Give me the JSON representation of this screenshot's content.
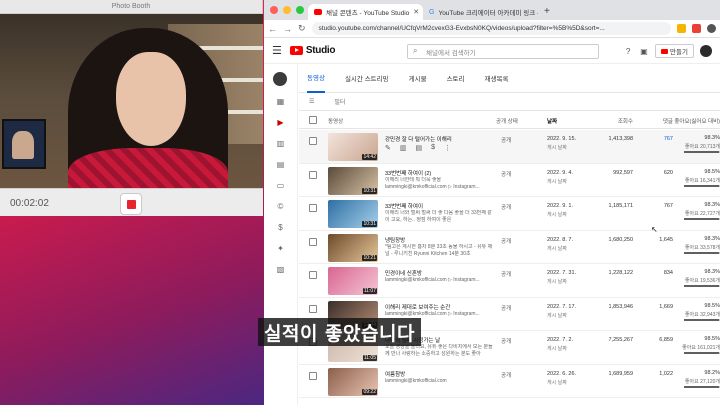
{
  "photo_booth": {
    "title": "Photo Booth",
    "timer": "00:02:02"
  },
  "browser": {
    "tabs": [
      {
        "label": "채널 콘텐츠 - YouTube Studio",
        "active": true
      },
      {
        "label": "YouTube 크리에이터 아카데미 링크 - ",
        "active": false
      }
    ],
    "new_tab": "+",
    "url": "studio.youtube.com/channel/UCfqVrM2cvexG3-EvxbsN0KQ/videos/upload?filter=%5B%5D&sort=..."
  },
  "studio": {
    "logo": "Studio",
    "search_placeholder": "채널에서 검색하기",
    "create_label": "만들기",
    "tabs": [
      "동영상",
      "실시간 스트리밍",
      "게시물",
      "스토리",
      "재생목록"
    ],
    "filter_label": "필터",
    "columns": {
      "video": "동영상",
      "visibility": "공개 상태",
      "date": "날짜",
      "views": "조회수",
      "comments": "댓글",
      "likes": "좋아요(싫어요 대비)"
    },
    "videos": [
      {
        "title": "강민경 잘 다 털어가는 이해리",
        "desc": "",
        "duration": "14:42",
        "visibility": "공개",
        "date": "2022. 9. 15.",
        "status": "게시 날짜",
        "views": "1,413,398",
        "comments": "767",
        "comments_link": true,
        "like_pct": "98.3%",
        "like_count": "좋아요 20,713개",
        "like_ratio": 0.983,
        "thumb": [
          "#f2e4dc",
          "#c9a48e"
        ],
        "hover": true
      },
      {
        "title": "33번번째 하여이 (2)",
        "desc": "이해리 너한테 뭐 더욱 좋을 lammingki@kmkofficial.com ▷ Instagram...",
        "duration": "10:31",
        "visibility": "공개",
        "date": "2022. 9. 4.",
        "status": "게시 날짜",
        "views": "992,597",
        "comments": "620",
        "comments_link": false,
        "like_pct": "98.5%",
        "like_count": "좋아요 16,341개",
        "like_ratio": 0.985,
        "thumb": [
          "#5a4a3a",
          "#d9c3a6"
        ],
        "hover": false
      },
      {
        "title": "33번번째 하여이",
        "desc": "이해리 너와 벌써 벌써 더 좋 다음 좋을 더 33번째 같이 고요, 하는.. 정점 하여이 좋은",
        "duration": "10:31",
        "visibility": "공개",
        "date": "2022. 9. 1.",
        "status": "게시 날짜",
        "views": "1,185,171",
        "comments": "767",
        "comments_link": false,
        "like_pct": "98.3%",
        "like_count": "좋아요 22,727개",
        "like_ratio": 0.983,
        "thumb": [
          "#2d6fa3",
          "#a7d0ea"
        ],
        "hover": false
      },
      {
        "title": "냉팀장방",
        "desc": "*팀고은 계시한 흥차 8분 33초 동물 하시고 - 유튜 채널 - 루니키친 Ryunni Kitchen 14분 30초",
        "duration": "10:21",
        "visibility": "공개",
        "date": "2022. 8. 7.",
        "status": "게시 날짜",
        "views": "1,680,250",
        "comments": "1,645",
        "comments_link": false,
        "like_pct": "98.3%",
        "like_count": "좋아요 33,578개",
        "like_ratio": 0.983,
        "thumb": [
          "#6e4a2c",
          "#e6c79b"
        ],
        "hover": false
      },
      {
        "title": "민경이네 신혼방",
        "desc": "lammingki@kmkofficial.com ▷ Instagram...",
        "duration": "11:07",
        "visibility": "공개",
        "date": "2022. 7. 31.",
        "status": "게시 날짜",
        "views": "1,228,122",
        "comments": "834",
        "comments_link": false,
        "like_pct": "98.3%",
        "like_count": "좋아요 19,536개",
        "like_ratio": 0.983,
        "thumb": [
          "#d9658f",
          "#f5c6d6"
        ],
        "hover": false
      },
      {
        "title": "이해리 제대로 보여주는 순간",
        "desc": "lammingki@kmkofficial.com ▷ Instagram...",
        "duration": "12:44",
        "visibility": "공개",
        "date": "2022. 7. 17.",
        "status": "게시 날짜",
        "views": "1,853,946",
        "comments": "1,669",
        "comments_link": false,
        "like_pct": "98.5%",
        "like_count": "좋아요 32,943개",
        "like_ratio": 0.985,
        "thumb": [
          "#3a2e2a",
          "#b48b72"
        ],
        "hover": false
      },
      {
        "title": "다비치 탱페 시청가는 날",
        "desc": "오늘 영상을 올리요, 유튜 좋은 다비치에서 모든 분들 께 만나 사랑하는 소중하고 성원하는 분도 좋아",
        "duration": "11:05",
        "visibility": "공개",
        "date": "2022. 7. 2.",
        "status": "게시 날짜",
        "views": "7,255,267",
        "comments": "6,859",
        "comments_link": false,
        "like_pct": "98.5%",
        "like_count": "좋아요 161,021개",
        "like_ratio": 0.985,
        "thumb": [
          "#c9b7a9",
          "#f1e3d7"
        ],
        "hover": false
      },
      {
        "title": "여름참방",
        "desc": "lammingki@kmkofficial.com",
        "duration": "09:22",
        "visibility": "공개",
        "date": "2022. 6. 26.",
        "status": "게시 날짜",
        "views": "1,689,959",
        "comments": "1,022",
        "comments_link": false,
        "like_pct": "98.2%",
        "like_count": "좋아요 27,120개",
        "like_ratio": 0.982,
        "thumb": [
          "#8b5e4b",
          "#e9c6b3"
        ],
        "hover": false
      }
    ]
  },
  "caption": "실적이 좋았습니다",
  "colors": {
    "yt_red": "#ff0000",
    "link_blue": "#065fd4",
    "record_red": "#e8252d"
  }
}
